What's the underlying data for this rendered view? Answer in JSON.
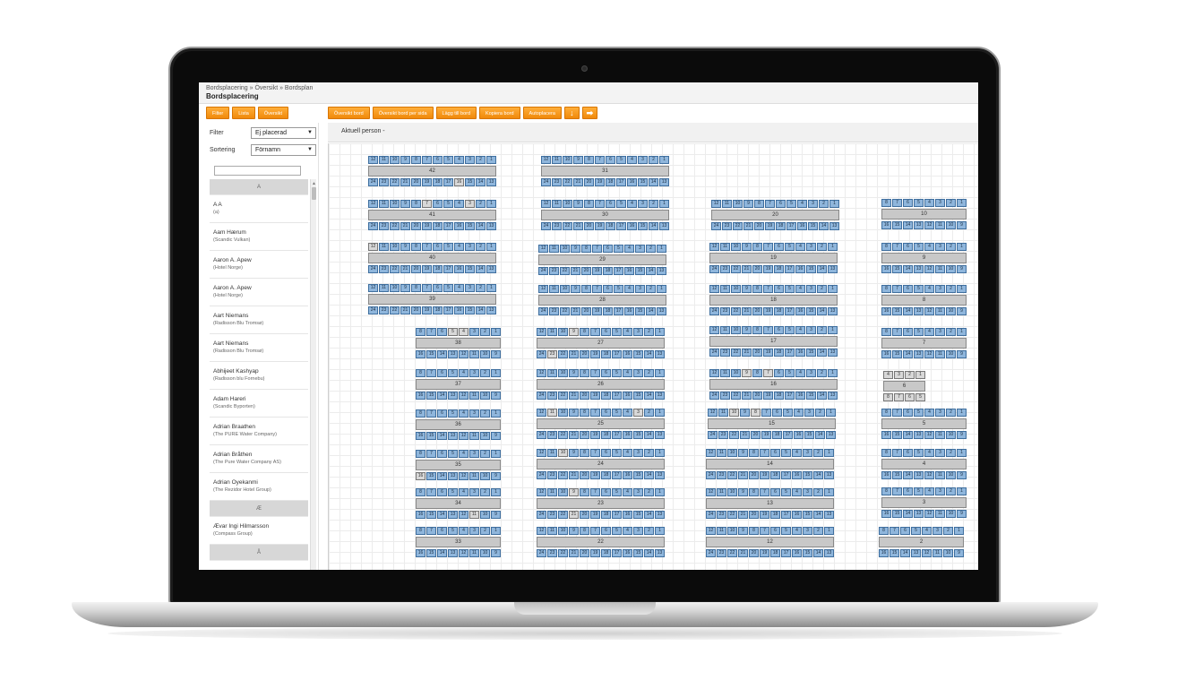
{
  "header": {
    "breadcrumb": "Bordsplacering » Översikt » Bordsplan",
    "title": "Bordsplacering"
  },
  "toolbar_left": [
    "Filter",
    "Lista",
    "Översikt"
  ],
  "toolbar_right": [
    "Översikt bord",
    "Översikt bord per sida",
    "Lägg till bord",
    "Kopiera bord",
    "Autoplacera"
  ],
  "toolbar_icons": {
    "down": "↓",
    "right": "➡"
  },
  "filter": {
    "filter_label": "Filter",
    "filter_value": "Ej placerad",
    "sort_label": "Sortering",
    "sort_value": "Förnamn"
  },
  "current_person": "Aktuell person  -",
  "list": [
    {
      "letter": "A"
    },
    {
      "name": "A A",
      "org": "(a)"
    },
    {
      "name": "Aam Hærum",
      "org": "(Scandic Vulkan)"
    },
    {
      "name": "Aaron A. Apew",
      "org": "(Hotel Norge)"
    },
    {
      "name": "Aaron A. Apew",
      "org": "(Hotel Norge)"
    },
    {
      "name": "Aart Niemans",
      "org": "(Radisson Blu Tromsø)"
    },
    {
      "name": "Aart Niemans",
      "org": "(Radisson Blu Tromsø)"
    },
    {
      "name": "Abhijeet Kashyap",
      "org": "(Radisson blu Fornebu)"
    },
    {
      "name": "Adam Hareri",
      "org": "(Scandic Byporten)"
    },
    {
      "name": "Adrian Braathen",
      "org": "(The PURE Water Company)"
    },
    {
      "name": "Adrian Bråthen",
      "org": "(The Pure Water Company AS)"
    },
    {
      "name": "Adrian Oyekanmi",
      "org": "(The Rezidor Hotel Group)"
    },
    {
      "letter": "Æ"
    },
    {
      "name": "Ævar Ingi Hilmarsson",
      "org": "(Compass Group)"
    },
    {
      "letter": "Å"
    }
  ],
  "tables": [
    {
      "id": "42",
      "n": 12,
      "taken": [
        16
      ]
    },
    {
      "id": "41",
      "n": 12,
      "taken": [
        3,
        7
      ]
    },
    {
      "id": "40",
      "n": 12,
      "taken": [
        12
      ]
    },
    {
      "id": "39",
      "n": 12,
      "taken": []
    },
    {
      "id": "38",
      "n": 8,
      "taken": [
        4,
        5
      ]
    },
    {
      "id": "37",
      "n": 8,
      "taken": []
    },
    {
      "id": "36",
      "n": 8,
      "taken": []
    },
    {
      "id": "35",
      "n": 8,
      "taken": [
        16
      ]
    },
    {
      "id": "34",
      "n": 8,
      "taken": [
        11
      ]
    },
    {
      "id": "33",
      "n": 8,
      "taken": []
    },
    {
      "id": "31",
      "n": 12,
      "taken": []
    },
    {
      "id": "30",
      "n": 12,
      "taken": []
    },
    {
      "id": "29",
      "n": 12,
      "taken": []
    },
    {
      "id": "28",
      "n": 12,
      "taken": []
    },
    {
      "id": "27",
      "n": 12,
      "taken": [
        9,
        23
      ]
    },
    {
      "id": "26",
      "n": 12,
      "taken": []
    },
    {
      "id": "25",
      "n": 12,
      "taken": [
        3,
        11
      ]
    },
    {
      "id": "24",
      "n": 12,
      "taken": [
        10
      ]
    },
    {
      "id": "23",
      "n": 12,
      "taken": [
        9,
        21
      ]
    },
    {
      "id": "22",
      "n": 12,
      "taken": []
    },
    {
      "id": "20",
      "n": 12,
      "taken": []
    },
    {
      "id": "19",
      "n": 12,
      "taken": []
    },
    {
      "id": "18",
      "n": 12,
      "taken": []
    },
    {
      "id": "17",
      "n": 12,
      "taken": []
    },
    {
      "id": "16",
      "n": 12,
      "taken": [
        7,
        9
      ]
    },
    {
      "id": "15",
      "n": 12,
      "taken": [
        8,
        10
      ]
    },
    {
      "id": "14",
      "n": 12,
      "taken": []
    },
    {
      "id": "13",
      "n": 12,
      "taken": []
    },
    {
      "id": "12",
      "n": 12,
      "taken": []
    },
    {
      "id": "10",
      "n": 8,
      "taken": []
    },
    {
      "id": "9",
      "n": 8,
      "taken": []
    },
    {
      "id": "8",
      "n": 8,
      "taken": []
    },
    {
      "id": "7",
      "n": 8,
      "taken": []
    },
    {
      "id": "6",
      "n": 4,
      "taken": [
        1,
        2,
        3,
        4,
        5,
        6,
        7,
        8
      ]
    },
    {
      "id": "5",
      "n": 8,
      "taken": []
    },
    {
      "id": "4",
      "n": 8,
      "taken": []
    },
    {
      "id": "3",
      "n": 8,
      "taken": []
    },
    {
      "id": "2",
      "n": 8,
      "taken": []
    }
  ]
}
